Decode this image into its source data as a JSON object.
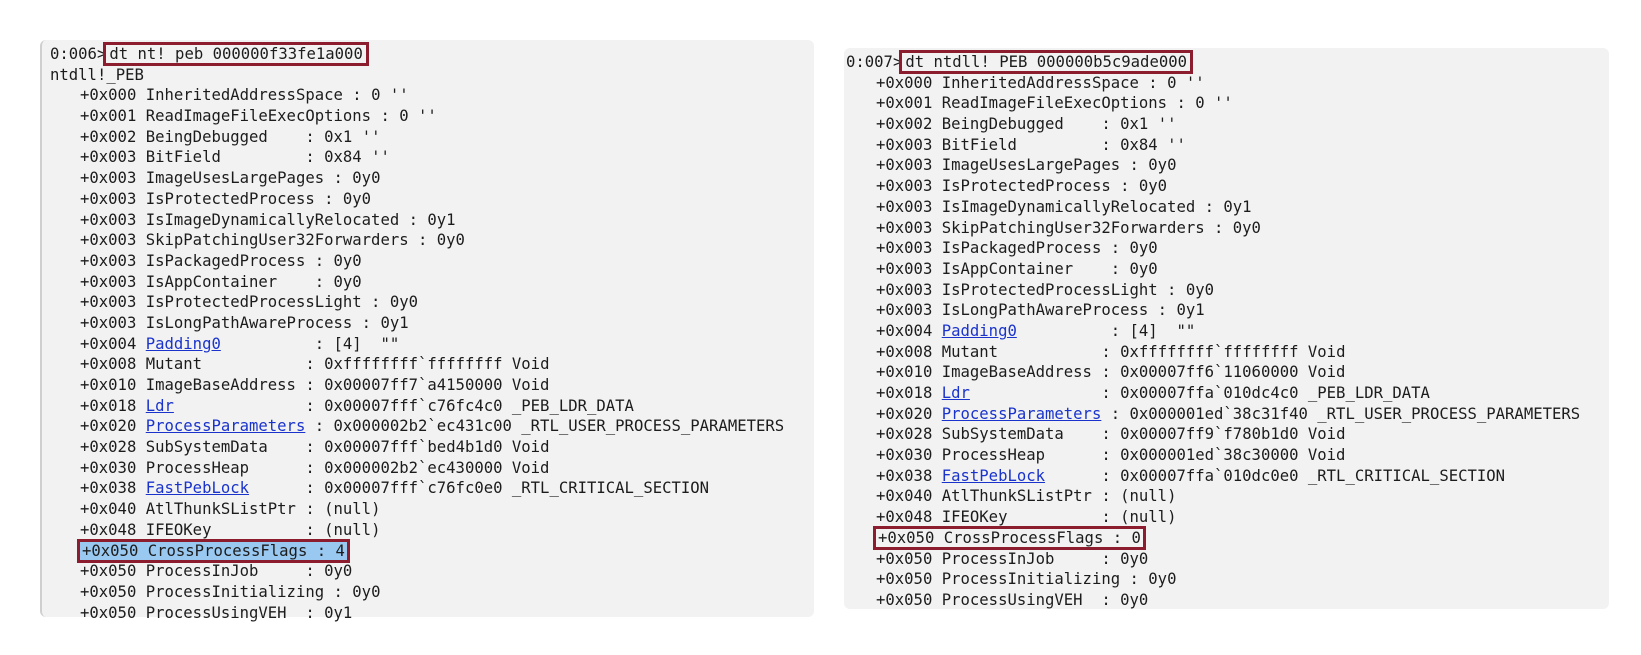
{
  "colors": {
    "panel_bg": "#f2f2f2",
    "link": "#1a33cc",
    "highlight_box": "#8c1d2f",
    "selection": "#99c8f0"
  },
  "left": {
    "prompt": "0:006>",
    "command": "dt nt! peb 000000f33fe1a000",
    "type_name": "ntdll!_PEB",
    "fields": [
      {
        "offset": "+0x000",
        "name": "InheritedAddressSpace",
        "sep": " : ",
        "value": "0 ''"
      },
      {
        "offset": "+0x001",
        "name": "ReadImageFileExecOptions",
        "sep": " : ",
        "value": "0 ''"
      },
      {
        "offset": "+0x002",
        "name": "BeingDebugged",
        "sep": "    : ",
        "value": "0x1 ''"
      },
      {
        "offset": "+0x003",
        "name": "BitField",
        "sep": "         : ",
        "value": "0x84 ''"
      },
      {
        "offset": "+0x003",
        "name": "ImageUsesLargePages",
        "sep": " : ",
        "value": "0y0"
      },
      {
        "offset": "+0x003",
        "name": "IsProtectedProcess",
        "sep": " : ",
        "value": "0y0"
      },
      {
        "offset": "+0x003",
        "name": "IsImageDynamicallyRelocated",
        "sep": " : ",
        "value": "0y1"
      },
      {
        "offset": "+0x003",
        "name": "SkipPatchingUser32Forwarders",
        "sep": " : ",
        "value": "0y0"
      },
      {
        "offset": "+0x003",
        "name": "IsPackagedProcess",
        "sep": " : ",
        "value": "0y0"
      },
      {
        "offset": "+0x003",
        "name": "IsAppContainer",
        "sep": "    : ",
        "value": "0y0"
      },
      {
        "offset": "+0x003",
        "name": "IsProtectedProcessLight",
        "sep": " : ",
        "value": "0y0"
      },
      {
        "offset": "+0x003",
        "name": "IsLongPathAwareProcess",
        "sep": " : ",
        "value": "0y1"
      },
      {
        "offset": "+0x004",
        "name": "Padding0",
        "sep": "          : ",
        "value": "[4]  \"\""
      },
      {
        "offset": "+0x008",
        "name": "Mutant",
        "sep": "           : ",
        "value": "0xffffffff`ffffffff Void"
      },
      {
        "offset": "+0x010",
        "name": "ImageBaseAddress",
        "sep": " : ",
        "value": "0x00007ff7`a4150000 Void"
      },
      {
        "offset": "+0x018",
        "name": "Ldr",
        "sep": "              : ",
        "value": "0x00007fff`c76fc4c0 _PEB_LDR_DATA"
      },
      {
        "offset": "+0x020",
        "name": "ProcessParameters",
        "sep": " : ",
        "value": "0x000002b2`ec431c00 _RTL_USER_PROCESS_PARAMETERS"
      },
      {
        "offset": "+0x028",
        "name": "SubSystemData",
        "sep": "    : ",
        "value": "0x00007fff`bed4b1d0 Void"
      },
      {
        "offset": "+0x030",
        "name": "ProcessHeap",
        "sep": "      : ",
        "value": "0x000002b2`ec430000 Void"
      },
      {
        "offset": "+0x038",
        "name": "FastPebLock",
        "sep": "      : ",
        "value": "0x00007fff`c76fc0e0 _RTL_CRITICAL_SECTION"
      },
      {
        "offset": "+0x040",
        "name": "AtlThunkSListPtr",
        "sep": " : ",
        "value": "(null)"
      },
      {
        "offset": "+0x048",
        "name": "IFEOKey",
        "sep": "          : ",
        "value": "(null)"
      },
      {
        "offset": "+0x050",
        "name": "CrossProcessFlags",
        "sep": " : ",
        "value": "4"
      },
      {
        "offset": "+0x050",
        "name": "ProcessInJob",
        "sep": "     : ",
        "value": "0y0"
      },
      {
        "offset": "+0x050",
        "name": "ProcessInitializing",
        "sep": " : ",
        "value": "0y0"
      },
      {
        "offset": "+0x050",
        "name": "ProcessUsingVEH",
        "sep": "  : ",
        "value": "0y1"
      }
    ]
  },
  "right": {
    "prompt": "0:007>",
    "command": "dt ntdll! PEB 000000b5c9ade000",
    "fields": [
      {
        "offset": "+0x000",
        "name": "InheritedAddressSpace",
        "sep": " : ",
        "value": "0 ''"
      },
      {
        "offset": "+0x001",
        "name": "ReadImageFileExecOptions",
        "sep": " : ",
        "value": "0 ''"
      },
      {
        "offset": "+0x002",
        "name": "BeingDebugged",
        "sep": "    : ",
        "value": "0x1 ''"
      },
      {
        "offset": "+0x003",
        "name": "BitField",
        "sep": "         : ",
        "value": "0x84 ''"
      },
      {
        "offset": "+0x003",
        "name": "ImageUsesLargePages",
        "sep": " : ",
        "value": "0y0"
      },
      {
        "offset": "+0x003",
        "name": "IsProtectedProcess",
        "sep": " : ",
        "value": "0y0"
      },
      {
        "offset": "+0x003",
        "name": "IsImageDynamicallyRelocated",
        "sep": " : ",
        "value": "0y1"
      },
      {
        "offset": "+0x003",
        "name": "SkipPatchingUser32Forwarders",
        "sep": " : ",
        "value": "0y0"
      },
      {
        "offset": "+0x003",
        "name": "IsPackagedProcess",
        "sep": " : ",
        "value": "0y0"
      },
      {
        "offset": "+0x003",
        "name": "IsAppContainer",
        "sep": "    : ",
        "value": "0y0"
      },
      {
        "offset": "+0x003",
        "name": "IsProtectedProcessLight",
        "sep": " : ",
        "value": "0y0"
      },
      {
        "offset": "+0x003",
        "name": "IsLongPathAwareProcess",
        "sep": " : ",
        "value": "0y1"
      },
      {
        "offset": "+0x004",
        "name": "Padding0",
        "sep": "          : ",
        "value": "[4]  \"\""
      },
      {
        "offset": "+0x008",
        "name": "Mutant",
        "sep": "           : ",
        "value": "0xffffffff`ffffffff Void"
      },
      {
        "offset": "+0x010",
        "name": "ImageBaseAddress",
        "sep": " : ",
        "value": "0x00007ff6`11060000 Void"
      },
      {
        "offset": "+0x018",
        "name": "Ldr",
        "sep": "              : ",
        "value": "0x00007ffa`010dc4c0 _PEB_LDR_DATA"
      },
      {
        "offset": "+0x020",
        "name": "ProcessParameters",
        "sep": " : ",
        "value": "0x000001ed`38c31f40 _RTL_USER_PROCESS_PARAMETERS"
      },
      {
        "offset": "+0x028",
        "name": "SubSystemData",
        "sep": "    : ",
        "value": "0x00007ff9`f780b1d0 Void"
      },
      {
        "offset": "+0x030",
        "name": "ProcessHeap",
        "sep": "      : ",
        "value": "0x000001ed`38c30000 Void"
      },
      {
        "offset": "+0x038",
        "name": "FastPebLock",
        "sep": "      : ",
        "value": "0x00007ffa`010dc0e0 _RTL_CRITICAL_SECTION"
      },
      {
        "offset": "+0x040",
        "name": "AtlThunkSListPtr",
        "sep": " : ",
        "value": "(null)"
      },
      {
        "offset": "+0x048",
        "name": "IFEOKey",
        "sep": "          : ",
        "value": "(null)"
      },
      {
        "offset": "+0x050",
        "name": "CrossProcessFlags",
        "sep": " : ",
        "value": "0"
      },
      {
        "offset": "+0x050",
        "name": "ProcessInJob",
        "sep": "     : ",
        "value": "0y0"
      },
      {
        "offset": "+0x050",
        "name": "ProcessInitializing",
        "sep": " : ",
        "value": "0y0"
      },
      {
        "offset": "+0x050",
        "name": "ProcessUsingVEH",
        "sep": "  : ",
        "value": "0y0"
      }
    ]
  },
  "link_fields": [
    "Padding0",
    "Ldr",
    "ProcessParameters",
    "FastPebLock"
  ],
  "boxed_field": "CrossProcessFlags"
}
